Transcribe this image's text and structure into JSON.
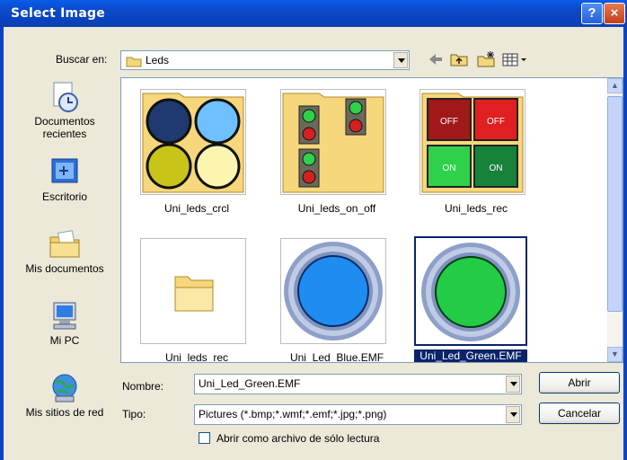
{
  "window": {
    "title": "Select Image",
    "help_glyph": "?",
    "close_glyph": "×"
  },
  "lookin": {
    "label": "Buscar en:",
    "value": "Leds"
  },
  "toolbar": {
    "back": "back-arrow-icon",
    "up": "up-folder-icon",
    "new_folder": "new-folder-icon",
    "views": "views-menu-icon"
  },
  "places": [
    {
      "label": "Documentos\nrecientes",
      "icon": "recent-documents-icon"
    },
    {
      "label": "Escritorio",
      "icon": "desktop-icon"
    },
    {
      "label": "Mis documentos",
      "icon": "my-documents-icon"
    },
    {
      "label": "Mi PC",
      "icon": "my-computer-icon"
    },
    {
      "label": "Mis sitios de red",
      "icon": "network-places-icon"
    }
  ],
  "files": [
    {
      "label": "Uni_leds_crcl"
    },
    {
      "label": "Uni_leds_on_off"
    },
    {
      "label": "Uni_leds_rec",
      "off1": "OFF",
      "off2": "OFF",
      "on1": "ON",
      "on2": "ON"
    },
    {
      "label": "Uni_leds_rec"
    },
    {
      "label": "Uni_Led_Blue.EMF"
    },
    {
      "label": "Uni_Led_Green.EMF",
      "selected": true
    }
  ],
  "filename": {
    "label": "Nombre:",
    "value": "Uni_Led_Green.EMF"
  },
  "filetype": {
    "label": "Tipo:",
    "value": "Pictures (*.bmp;*.wmf;*.emf;*.jpg;*.png)"
  },
  "readonly": {
    "label": "Abrir como archivo de sólo lectura"
  },
  "buttons": {
    "open": "Abrir",
    "cancel": "Cancelar"
  },
  "colors": {
    "title_bar": "#0a48c8",
    "selection": "#0a246a",
    "led_blue": "#1e8cf0",
    "led_green": "#22cc44"
  }
}
